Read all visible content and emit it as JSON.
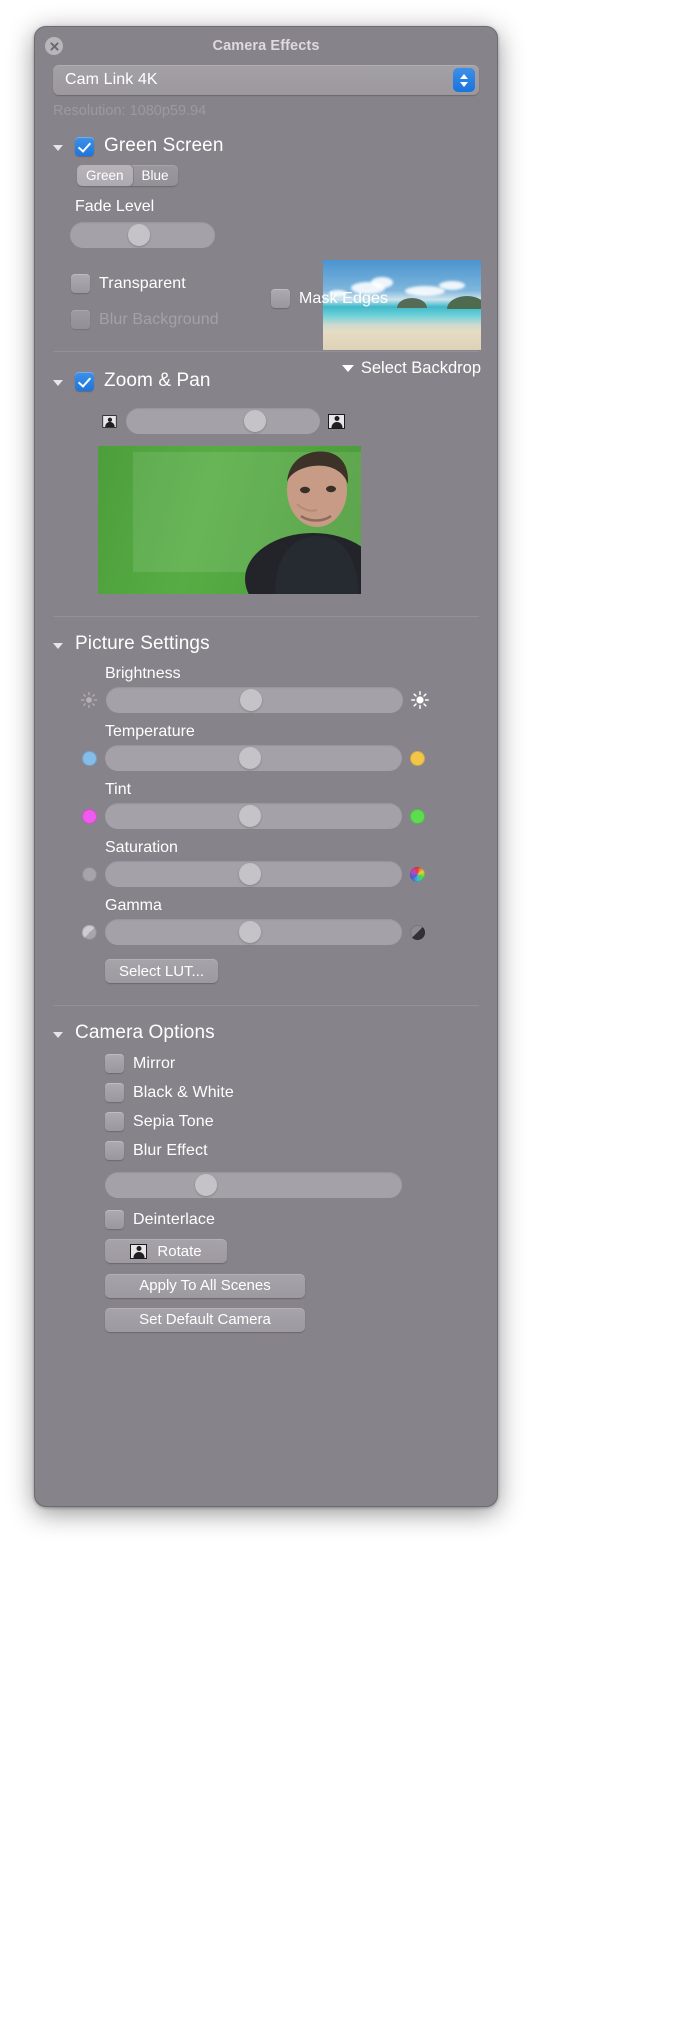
{
  "window": {
    "title": "Camera Effects",
    "close_icon": "close-icon"
  },
  "device": {
    "selected": "Cam Link 4K",
    "options": [
      "Cam Link 4K"
    ],
    "resolution": "Resolution: 1080p59.94"
  },
  "green_screen": {
    "title": "Green Screen",
    "enabled": true,
    "color_modes": [
      {
        "label": "Green",
        "selected": true
      },
      {
        "label": "Blue",
        "selected": false
      }
    ],
    "fade_level_label": "Fade Level",
    "fade_level_pct": 48,
    "transparent": {
      "label": "Transparent",
      "checked": false,
      "disabled": false
    },
    "blur_background": {
      "label": "Blur Background",
      "checked": false,
      "disabled": true
    },
    "mask_edges": {
      "label": "Mask Edges",
      "checked": false,
      "disabled": false
    },
    "select_backdrop_label": "Select Backdrop",
    "backdrop_thumbnail": "beach-backdrop-thumbnail"
  },
  "zoom_pan": {
    "title": "Zoom & Pan",
    "enabled": true,
    "min_icon": "person-small-icon",
    "max_icon": "person-large-icon",
    "zoom_pct": 64,
    "preview": "camera-preview-green-screen"
  },
  "picture_settings": {
    "title": "Picture Settings",
    "sliders": [
      {
        "label": "Brightness",
        "value_pct": 48,
        "left_icon": "sun-dim-icon",
        "right_icon": "sun-bright-icon",
        "left_color": "#b5b1b7",
        "right_color": "#ffffff"
      },
      {
        "label": "Temperature",
        "value_pct": 48,
        "left_icon": "blue-dot-icon",
        "right_icon": "amber-dot-icon",
        "left_color": "#84bdea",
        "right_color": "#f3c64a"
      },
      {
        "label": "Tint",
        "value_pct": 48,
        "left_icon": "magenta-dot-icon",
        "right_icon": "green-dot-icon",
        "left_color": "#ef5bee",
        "right_color": "#5ddc4f"
      },
      {
        "label": "Saturation",
        "value_pct": 48,
        "left_icon": "gray-dot-icon",
        "right_icon": "color-wheel-icon",
        "left_color": "#a7a3aa",
        "right_color": "#d94a4a"
      },
      {
        "label": "Gamma",
        "value_pct": 48,
        "left_icon": "gamma-light-icon",
        "right_icon": "gamma-dark-icon",
        "left_color": "#b8b4ba",
        "right_color": "#5a575c"
      }
    ],
    "select_lut_label": "Select LUT..."
  },
  "camera_options": {
    "title": "Camera Options",
    "checkboxes": [
      {
        "label": "Mirror",
        "checked": false
      },
      {
        "label": "Black & White",
        "checked": false
      },
      {
        "label": "Sepia Tone",
        "checked": false
      },
      {
        "label": "Blur Effect",
        "checked": false
      }
    ],
    "blur_amount_pct": 33,
    "deinterlace": {
      "label": "Deinterlace",
      "checked": false
    },
    "rotate_label": "Rotate",
    "rotate_icon": "person-portrait-icon",
    "apply_all_label": "Apply To All Scenes",
    "set_default_label": "Set Default Camera"
  },
  "colors": {
    "window_bg": "#87838a",
    "accent_blue": "#1b76de",
    "text_primary": "#ffffff",
    "text_dim": "#9d99a0",
    "track": "#a5a1a8",
    "knob": "#c6c3c8"
  }
}
